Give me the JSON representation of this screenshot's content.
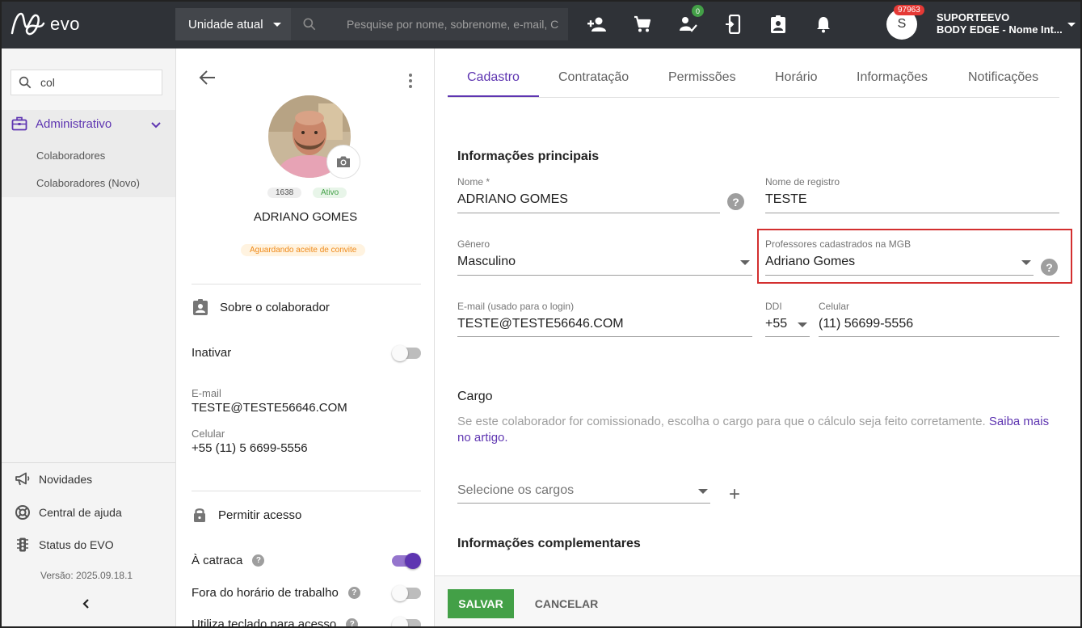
{
  "topbar": {
    "logo_text": "evo",
    "unit_label": "Unidade atual",
    "search_placeholder": "Pesquise por nome, sobrenome, e-mail, C",
    "tasks_badge": "0",
    "avatar_initial": "S",
    "notif_badge": "97963",
    "user_name": "SUPORTEEVO",
    "user_company": "BODY EDGE - Nome Int..."
  },
  "sidebar": {
    "search_value": "col",
    "menu_admin": "Administrativo",
    "sub_items": [
      "Colaboradores",
      "Colaboradores (Novo)"
    ],
    "novidades": "Novidades",
    "ajuda": "Central de ajuda",
    "status": "Status do EVO",
    "version": "Versão: 2025.09.18.1"
  },
  "profile": {
    "id": "1638",
    "status": "Ativo",
    "name": "ADRIANO GOMES",
    "invite": "Aguardando aceite de convite",
    "about_title": "Sobre o colaborador",
    "inactive_label": "Inativar",
    "email_label": "E-mail",
    "email_value": "TESTE@TESTE56646.COM",
    "phone_label": "Celular",
    "phone_value": "+55 (11) 5 6699-5556",
    "access_title": "Permitir acesso",
    "catraca": "À catraca",
    "fora": "Fora do horário de trabalho",
    "teclado": "Utiliza teclado para acesso"
  },
  "tabs": [
    "Cadastro",
    "Contratação",
    "Permissões",
    "Horário",
    "Informações",
    "Notificações"
  ],
  "form": {
    "section_main": "Informações principais",
    "nome_label": "Nome *",
    "nome_value": "ADRIANO GOMES",
    "registro_label": "Nome de registro",
    "registro_value": "TESTE",
    "genero_label": "Gênero",
    "genero_value": "Masculino",
    "mgb_label": "Professores cadastrados na MGB",
    "mgb_value": "Adriano Gomes",
    "email_label": "E-mail (usado para o login)",
    "email_value": "TESTE@TESTE56646.COM",
    "ddi_label": "DDI",
    "ddi_value": "+55",
    "celular_label": "Celular",
    "celular_value": "(11) 56699-5556",
    "cargo_title": "Cargo",
    "cargo_desc": "Se este colaborador for comissionado, escolha o cargo para que o cálculo seja feito corretamente. ",
    "cargo_link": "Saiba mais no artigo.",
    "cargos_placeholder": "Selecione os cargos",
    "section_extra": "Informações complementares"
  },
  "footer": {
    "save": "SALVAR",
    "cancel": "CANCELAR"
  },
  "colors": {
    "accent": "#5e35b1",
    "save": "#43a047",
    "highlight": "#d32f2f",
    "topbar": "#2f3237"
  }
}
